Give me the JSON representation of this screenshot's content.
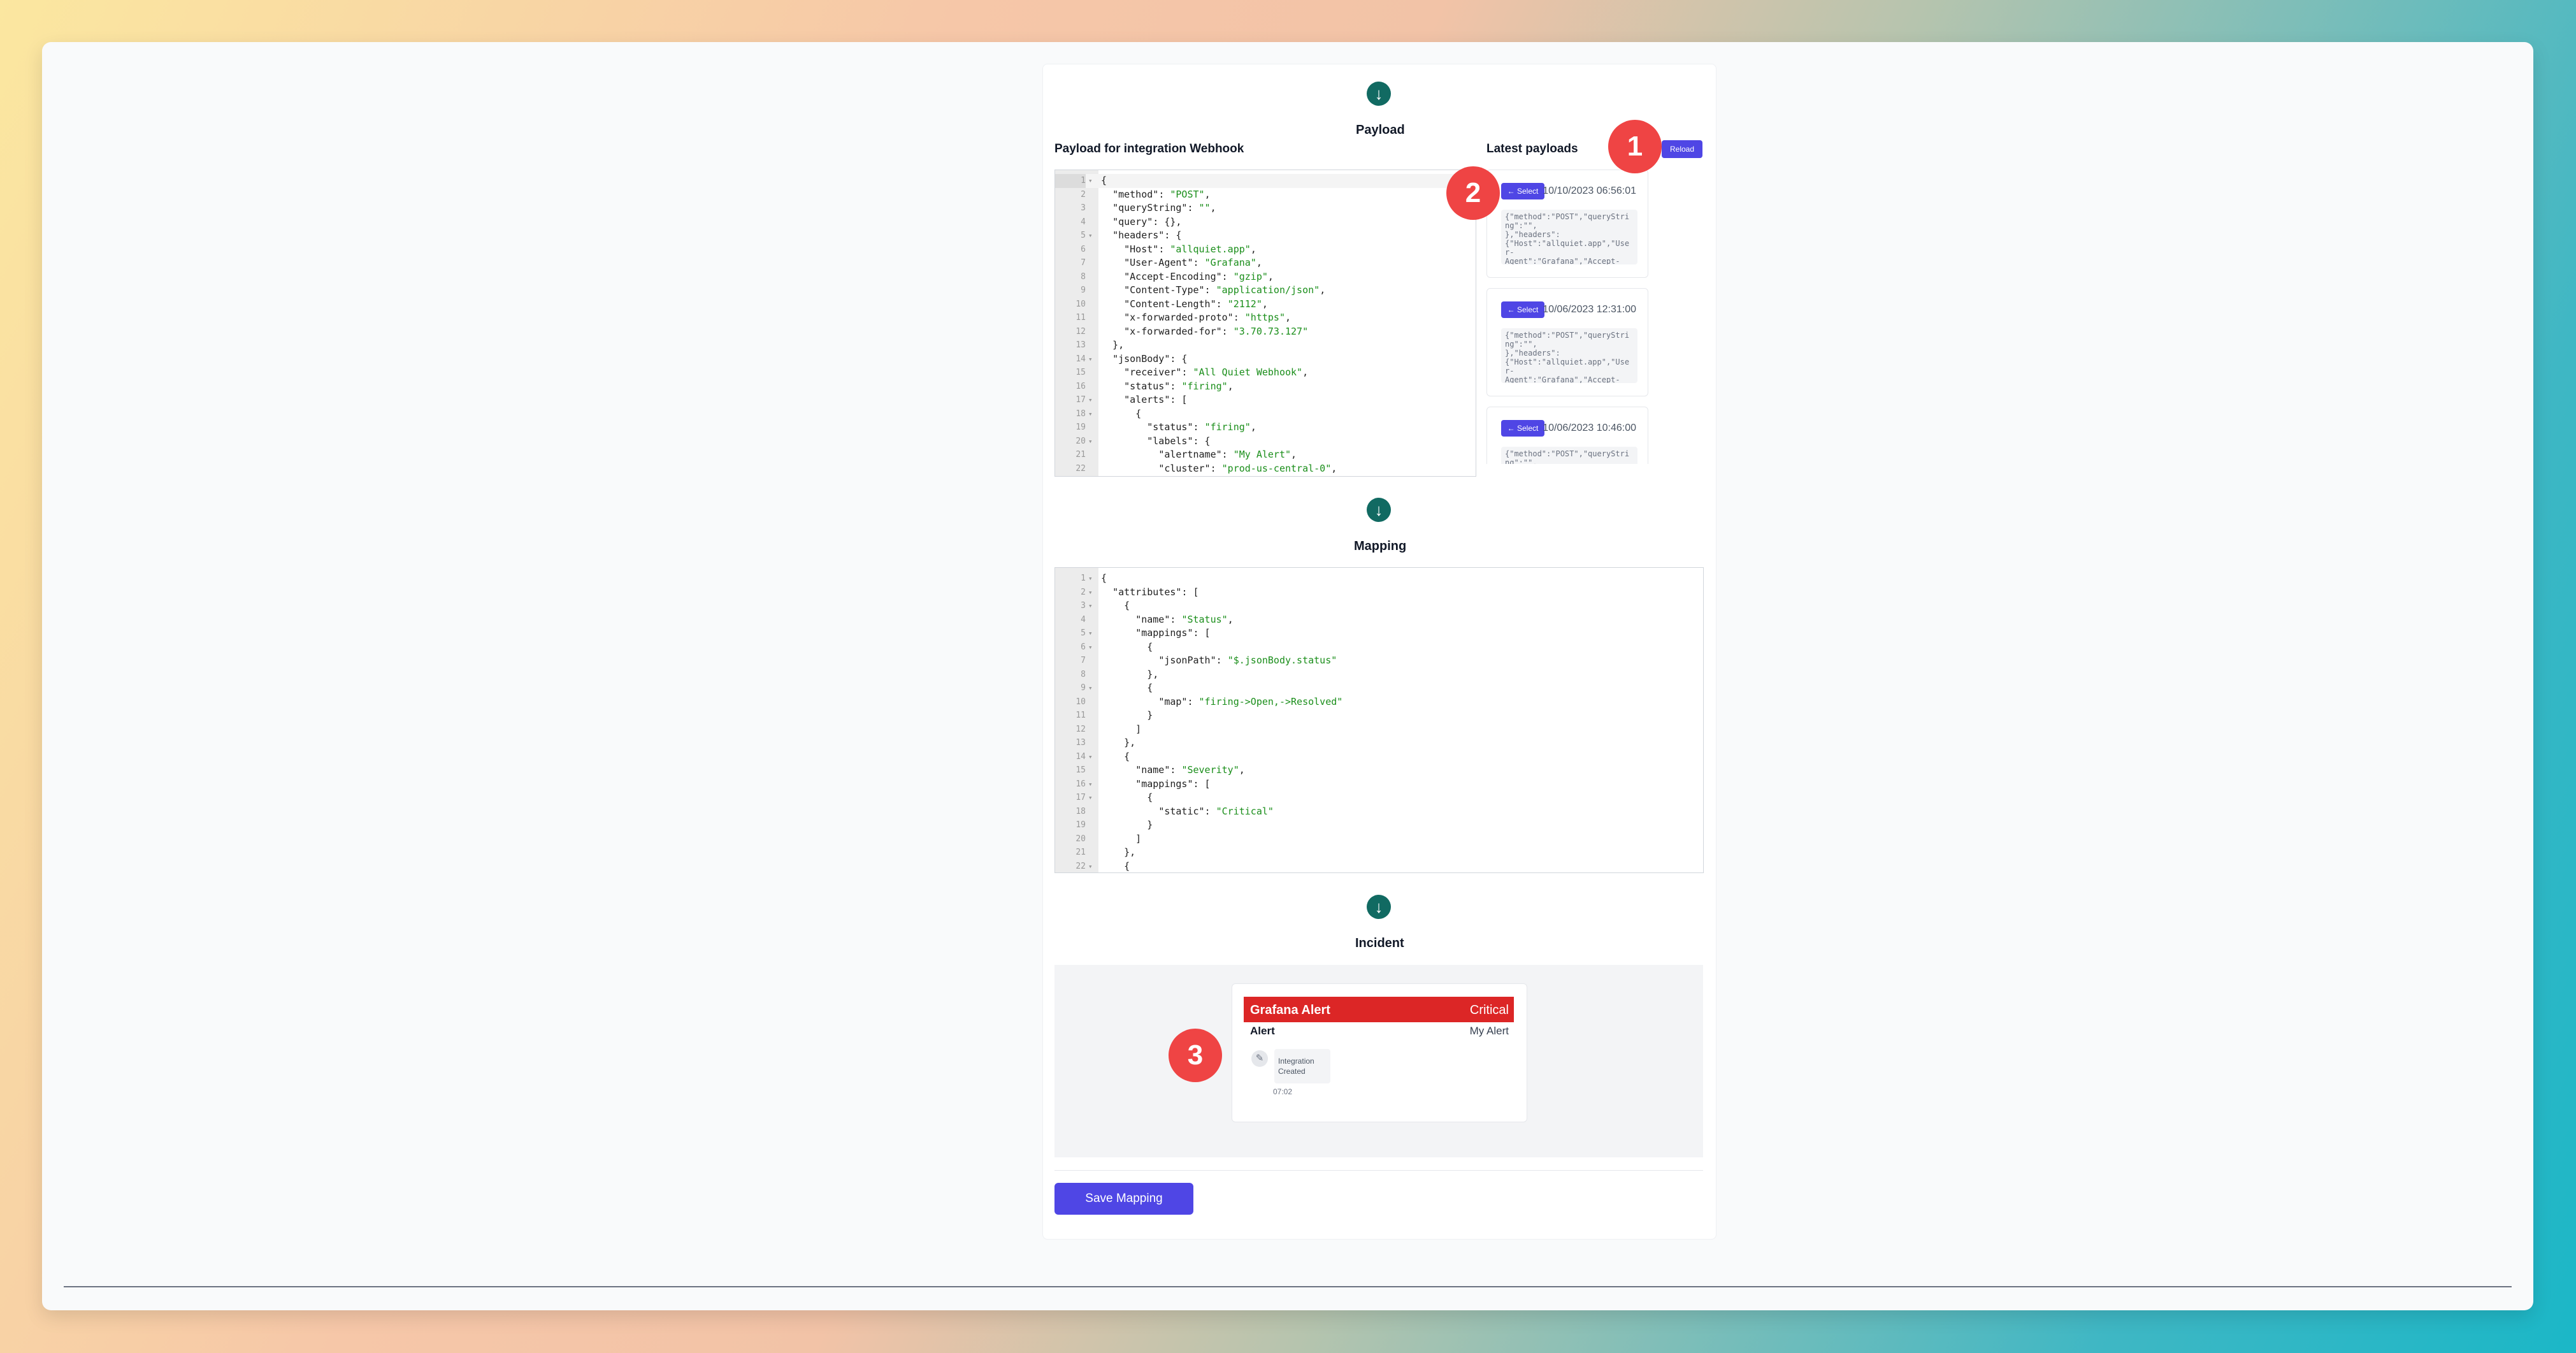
{
  "sections": {
    "payload_title": "Payload",
    "mapping_title": "Mapping",
    "incident_title": "Incident"
  },
  "payload_editor": {
    "label": "Payload for integration Webhook",
    "lines": [
      {
        "n": "1",
        "fold": "▾",
        "html": "<span class='p'>{</span>"
      },
      {
        "n": "2",
        "fold": "",
        "html": "  <span class='k'>\"method\"</span>: <span class='s'>\"POST\"</span>,"
      },
      {
        "n": "3",
        "fold": "",
        "html": "  <span class='k'>\"queryString\"</span>: <span class='s'>\"\"</span>,"
      },
      {
        "n": "4",
        "fold": "",
        "html": "  <span class='k'>\"query\"</span>: {},"
      },
      {
        "n": "5",
        "fold": "▾",
        "html": "  <span class='k'>\"headers\"</span>: {"
      },
      {
        "n": "6",
        "fold": "",
        "html": "    <span class='k'>\"Host\"</span>: <span class='s'>\"allquiet.app\"</span>,"
      },
      {
        "n": "7",
        "fold": "",
        "html": "    <span class='k'>\"User-Agent\"</span>: <span class='s'>\"Grafana\"</span>,"
      },
      {
        "n": "8",
        "fold": "",
        "html": "    <span class='k'>\"Accept-Encoding\"</span>: <span class='s'>\"gzip\"</span>,"
      },
      {
        "n": "9",
        "fold": "",
        "html": "    <span class='k'>\"Content-Type\"</span>: <span class='s'>\"application/json\"</span>,"
      },
      {
        "n": "10",
        "fold": "",
        "html": "    <span class='k'>\"Content-Length\"</span>: <span class='s'>\"2112\"</span>,"
      },
      {
        "n": "11",
        "fold": "",
        "html": "    <span class='k'>\"x-forwarded-proto\"</span>: <span class='s'>\"https\"</span>,"
      },
      {
        "n": "12",
        "fold": "",
        "html": "    <span class='k'>\"x-forwarded-for\"</span>: <span class='s'>\"3.70.73.127\"</span>"
      },
      {
        "n": "13",
        "fold": "",
        "html": "  },"
      },
      {
        "n": "14",
        "fold": "▾",
        "html": "  <span class='k'>\"jsonBody\"</span>: {"
      },
      {
        "n": "15",
        "fold": "",
        "html": "    <span class='k'>\"receiver\"</span>: <span class='s'>\"All Quiet Webhook\"</span>,"
      },
      {
        "n": "16",
        "fold": "",
        "html": "    <span class='k'>\"status\"</span>: <span class='s'>\"firing\"</span>,"
      },
      {
        "n": "17",
        "fold": "▾",
        "html": "    <span class='k'>\"alerts\"</span>: ["
      },
      {
        "n": "18",
        "fold": "▾",
        "html": "      {"
      },
      {
        "n": "19",
        "fold": "",
        "html": "        <span class='k'>\"status\"</span>: <span class='s'>\"firing\"</span>,"
      },
      {
        "n": "20",
        "fold": "▾",
        "html": "        <span class='k'>\"labels\"</span>: {"
      },
      {
        "n": "21",
        "fold": "",
        "html": "          <span class='k'>\"alertname\"</span>: <span class='s'>\"My Alert\"</span>,"
      },
      {
        "n": "22",
        "fold": "",
        "html": "          <span class='k'>\"cluster\"</span>: <span class='s'>\"prod-us-central-0\"</span>,"
      }
    ]
  },
  "latest_payloads": {
    "title": "Latest payloads",
    "reload_label": "Reload",
    "select_label": "← Select",
    "items": [
      {
        "time": "10/10/2023 06:56:01",
        "preview": "{\"method\":\"POST\",\"queryString\":\"\",\n},\"headers\":\n{\"Host\":\"allquiet.app\",\"User-\nAgent\":\"Grafana\",\"Accept-\nEncoding\":\"..."
      },
      {
        "time": "10/06/2023 12:31:00",
        "preview": "{\"method\":\"POST\",\"queryString\":\"\",\n},\"headers\":\n{\"Host\":\"allquiet.app\",\"User-\nAgent\":\"Grafana\",\"Accept-\nEncoding\":\"..."
      },
      {
        "time": "10/06/2023 10:46:00",
        "preview": "{\"method\":\"POST\",\"queryString\":\"\",\n},\"headers\":"
      }
    ]
  },
  "mapping_editor": {
    "lines": [
      {
        "n": "1",
        "fold": "▾",
        "html": "<span class='p'>{</span>"
      },
      {
        "n": "2",
        "fold": "▾",
        "html": "  <span class='k'>\"attributes\"</span>: ["
      },
      {
        "n": "3",
        "fold": "▾",
        "html": "    {"
      },
      {
        "n": "4",
        "fold": "",
        "html": "      <span class='k'>\"name\"</span>: <span class='s'>\"Status\"</span>,"
      },
      {
        "n": "5",
        "fold": "▾",
        "html": "      <span class='k'>\"mappings\"</span>: ["
      },
      {
        "n": "6",
        "fold": "▾",
        "html": "        {"
      },
      {
        "n": "7",
        "fold": "",
        "html": "          <span class='k'>\"jsonPath\"</span>: <span class='s'>\"$.jsonBody.status\"</span>"
      },
      {
        "n": "8",
        "fold": "",
        "html": "        },"
      },
      {
        "n": "9",
        "fold": "▾",
        "html": "        {"
      },
      {
        "n": "10",
        "fold": "",
        "html": "          <span class='k'>\"map\"</span>: <span class='s'>\"firing->Open,->Resolved\"</span>"
      },
      {
        "n": "11",
        "fold": "",
        "html": "        }"
      },
      {
        "n": "12",
        "fold": "",
        "html": "      ]"
      },
      {
        "n": "13",
        "fold": "",
        "html": "    },"
      },
      {
        "n": "14",
        "fold": "▾",
        "html": "    {"
      },
      {
        "n": "15",
        "fold": "",
        "html": "      <span class='k'>\"name\"</span>: <span class='s'>\"Severity\"</span>,"
      },
      {
        "n": "16",
        "fold": "▾",
        "html": "      <span class='k'>\"mappings\"</span>: ["
      },
      {
        "n": "17",
        "fold": "▾",
        "html": "        {"
      },
      {
        "n": "18",
        "fold": "",
        "html": "          <span class='k'>\"static\"</span>: <span class='s'>\"Critical\"</span>"
      },
      {
        "n": "19",
        "fold": "",
        "html": "        }"
      },
      {
        "n": "20",
        "fold": "",
        "html": "      ]"
      },
      {
        "n": "21",
        "fold": "",
        "html": "    },"
      },
      {
        "n": "22",
        "fold": "▾",
        "html": "    {"
      }
    ]
  },
  "incident": {
    "title": "Grafana Alert",
    "severity": "Critical",
    "alert_label": "Alert",
    "alert_value": "My Alert",
    "event_text": "Integration Created",
    "event_time": "07:02"
  },
  "markers": [
    "1",
    "2",
    "3"
  ],
  "save_label": "Save Mapping",
  "icons": {
    "arrow": "arrow-down-circle-icon",
    "timeline": "link-icon"
  },
  "colors": {
    "accent": "#4f46e5",
    "arrow": "#116a62",
    "critical": "#dc2626",
    "marker": "#ef4444"
  }
}
